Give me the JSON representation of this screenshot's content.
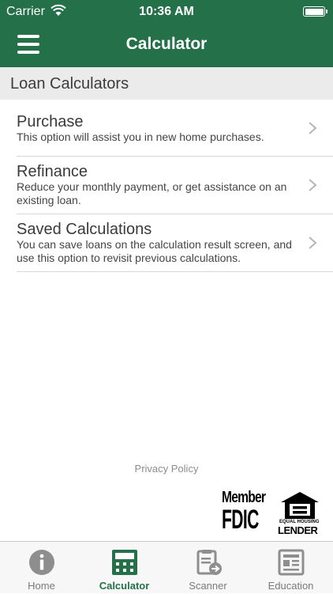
{
  "status_bar": {
    "carrier": "Carrier",
    "time": "10:36 AM"
  },
  "nav": {
    "title": "Calculator",
    "menu_icon": "hamburger-menu-icon"
  },
  "section": {
    "title": "Loan Calculators"
  },
  "items": [
    {
      "title": "Purchase",
      "description": "This option will assist you in new home purchases."
    },
    {
      "title": "Refinance",
      "description": "Reduce your monthly payment, or get assistance on an existing loan."
    },
    {
      "title": "Saved Calculations",
      "description": "You can save loans on the calculation result screen, and use this option to revisit previous calculations."
    }
  ],
  "footer": {
    "privacy_link": "Privacy Policy",
    "fdic": {
      "member": "Member",
      "name": "FDIC"
    },
    "equal_housing": {
      "line1": "EQUAL HOUSING",
      "line2": "LENDER"
    }
  },
  "tabs": [
    {
      "label": "Home",
      "icon": "info-icon",
      "active": false
    },
    {
      "label": "Calculator",
      "icon": "calculator-icon",
      "active": true
    },
    {
      "label": "Scanner",
      "icon": "scanner-icon",
      "active": false
    },
    {
      "label": "Education",
      "icon": "newspaper-icon",
      "active": false
    }
  ],
  "colors": {
    "brand_green": "#247049",
    "active_tab": "#247049",
    "inactive_icon": "#8e8e8e"
  }
}
